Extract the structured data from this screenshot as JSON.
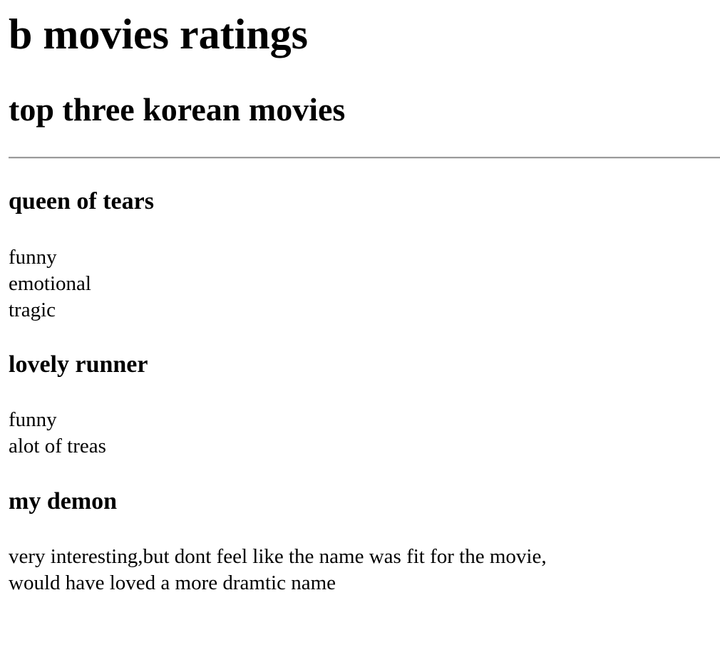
{
  "page": {
    "title": "b movies ratings",
    "subtitle": "top three korean movies"
  },
  "movies": [
    {
      "title": "queen of tears",
      "notes": [
        "funny",
        "emotional",
        "tragic"
      ]
    },
    {
      "title": "lovely runner",
      "notes": [
        "funny",
        "alot of treas"
      ]
    },
    {
      "title": "my demon",
      "notes": [
        "very interesting,but dont feel like the name was fit for the movie,",
        "would have loved a more dramtic name"
      ]
    }
  ],
  "colors": {
    "text": "#000000",
    "background": "#ffffff",
    "divider": "#9a9a9a"
  }
}
